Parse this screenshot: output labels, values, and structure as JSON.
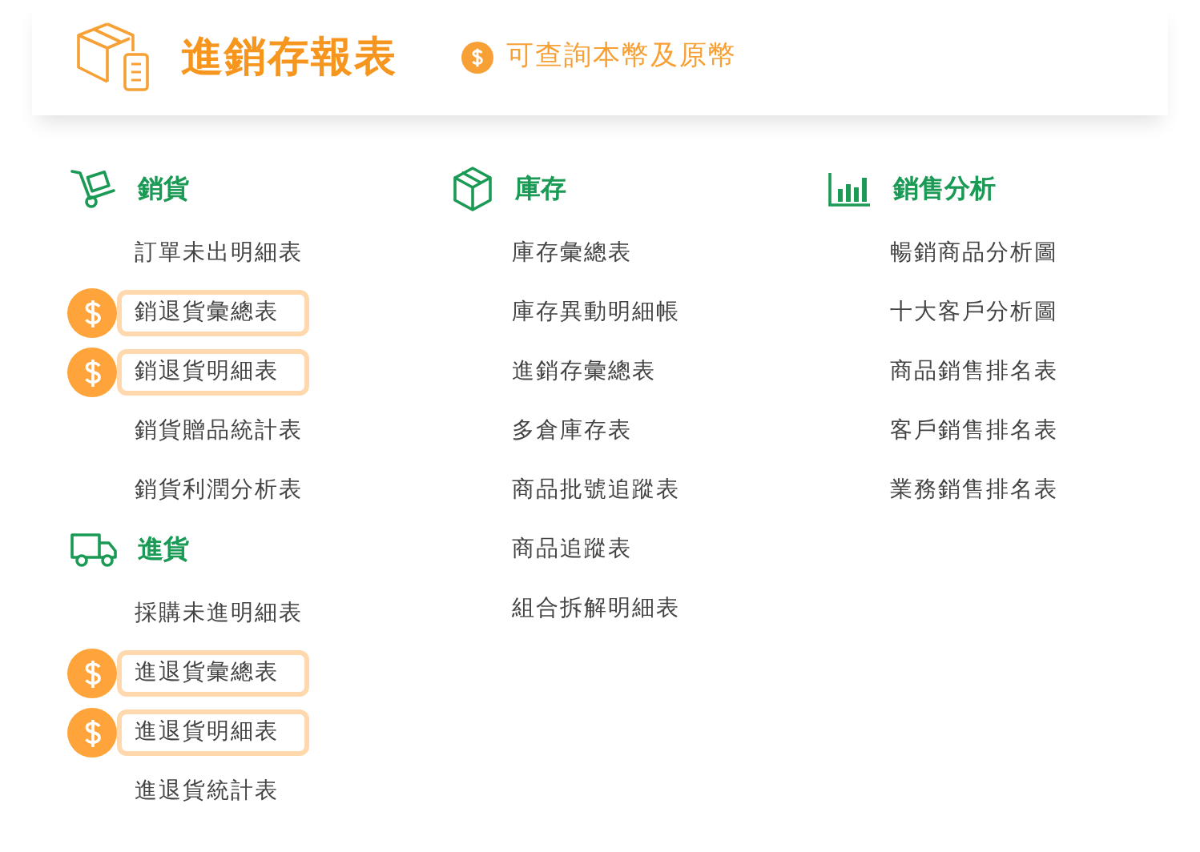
{
  "header": {
    "title": "進銷存報表",
    "note": "可查詢本幣及原幣"
  },
  "columns": [
    {
      "sections": [
        {
          "kind": "cart",
          "title": "銷貨",
          "items": [
            {
              "label": "訂單未出明細表",
              "currency": false
            },
            {
              "label": "銷退貨彙總表",
              "currency": true
            },
            {
              "label": "銷退貨明細表",
              "currency": true
            },
            {
              "label": "銷貨贈品統計表",
              "currency": false
            },
            {
              "label": "銷貨利潤分析表",
              "currency": false
            }
          ]
        },
        {
          "kind": "truck",
          "title": "進貨",
          "items": [
            {
              "label": "採購未進明細表",
              "currency": false
            },
            {
              "label": "進退貨彙總表",
              "currency": true
            },
            {
              "label": "進退貨明細表",
              "currency": true
            },
            {
              "label": "進退貨統計表",
              "currency": false
            }
          ]
        }
      ]
    },
    {
      "sections": [
        {
          "kind": "box",
          "title": "庫存",
          "items": [
            {
              "label": "庫存彙總表",
              "currency": false
            },
            {
              "label": "庫存異動明細帳",
              "currency": false
            },
            {
              "label": "進銷存彙總表",
              "currency": false
            },
            {
              "label": "多倉庫存表",
              "currency": false
            },
            {
              "label": "商品批號追蹤表",
              "currency": false
            },
            {
              "label": "商品追蹤表",
              "currency": false
            },
            {
              "label": "組合拆解明細表",
              "currency": false
            }
          ]
        }
      ]
    },
    {
      "sections": [
        {
          "kind": "chart",
          "title": "銷售分析",
          "items": [
            {
              "label": "暢銷商品分析圖",
              "currency": false
            },
            {
              "label": "十大客戶分析圖",
              "currency": false
            },
            {
              "label": "商品銷售排名表",
              "currency": false
            },
            {
              "label": "客戶銷售排名表",
              "currency": false
            },
            {
              "label": "業務銷售排名表",
              "currency": false
            }
          ]
        }
      ]
    }
  ]
}
